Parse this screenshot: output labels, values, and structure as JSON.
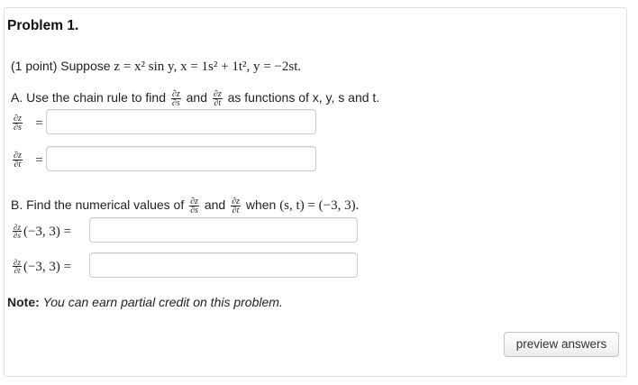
{
  "problem": {
    "title": "Problem 1.",
    "points": "(1 point) Suppose",
    "statement_math": "z = x² sin y, x = 1s² + 1t², y = −2st."
  },
  "part_a": {
    "prompt_start": "A. Use the chain rule to find",
    "and": "and",
    "prompt_end": "as functions of x, y, s and t.",
    "dz_ds_num": "∂z",
    "dz_ds_den": "∂s",
    "dz_dt_num": "∂z",
    "dz_dt_den": "∂t",
    "equals": "=",
    "answer_dzds_value": "",
    "answer_dzdt_value": ""
  },
  "part_b": {
    "prompt_start": "B. Find the numerical values of",
    "and": "and",
    "when": "when",
    "point_math": "(s, t) = (−3, 3).",
    "eval_point": "(−3, 3) =",
    "answer_dzds_value": "",
    "answer_dzdt_value": ""
  },
  "note": {
    "label": "Note:",
    "text": "You can earn partial credit on this problem."
  },
  "buttons": {
    "preview": "preview answers"
  }
}
